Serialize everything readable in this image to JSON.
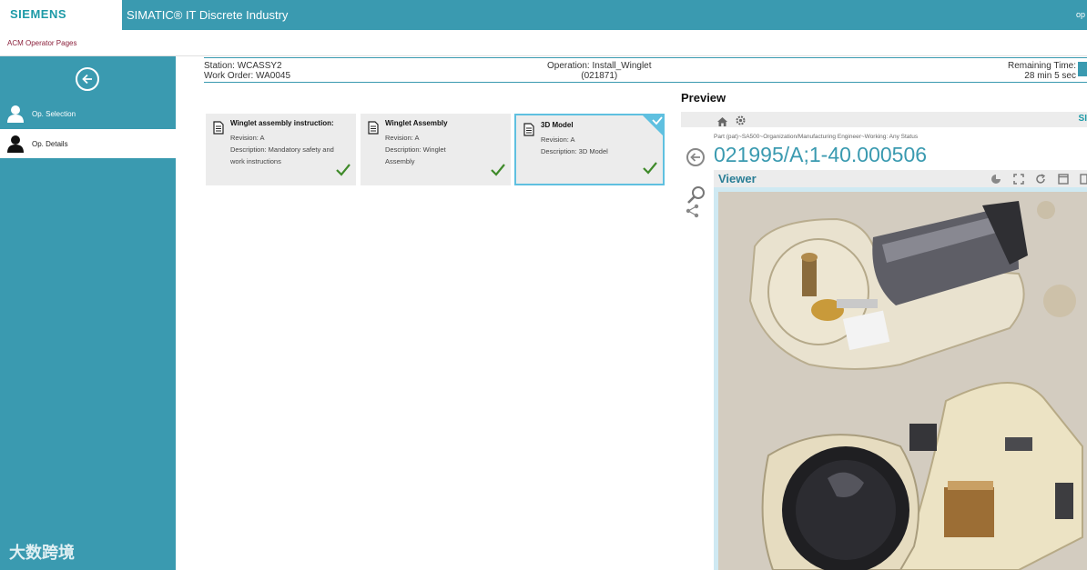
{
  "topbar": {
    "logo": "SIEMENS",
    "app_title": "SIMATIC® IT Discrete Industry",
    "right_text": "op"
  },
  "subbar": {
    "title": "ACM Operator Pages"
  },
  "sidebar": {
    "items": [
      {
        "label": "Op. Selection",
        "icon": "user-icon",
        "selected": false
      },
      {
        "label": "Op. Details",
        "icon": "user-icon",
        "selected": true
      }
    ],
    "watermark": "大数跨境"
  },
  "header": {
    "station": "Station: WCASSY2",
    "work_order": "Work Order: WA0045",
    "operation": "Operation: Install_Winglet",
    "operation_id": "(021871)",
    "remaining_label": "Remaining Time:",
    "remaining_value": "28 min 5 sec"
  },
  "cards": [
    {
      "title": "Winglet assembly instruction:",
      "revision": "Revision: A",
      "description": "Description: Mandatory safety and work instructions",
      "checked": true,
      "selected": false
    },
    {
      "title": "Winglet Assembly",
      "revision": "Revision: A",
      "description": "Description: Winglet Assembly",
      "checked": true,
      "selected": false
    },
    {
      "title": "3D Model",
      "revision": "Revision: A",
      "description": "Description: 3D Model",
      "checked": true,
      "selected": true
    }
  ],
  "preview": {
    "title": "Preview",
    "toolbar_brand": "SI",
    "breadcrumb": "Part (pat)~SA500~Organization/Manufacturing Engineer~Working: Any Status",
    "part_id": "021995/A;1-40.000506",
    "viewer_title": "Viewer",
    "viewer_image": "photo of disassembled motor and gear assembly"
  },
  "colors": {
    "accent": "#3a9ab0",
    "brand": "#1d9aa7",
    "check": "#3f8a2a",
    "selection_border": "#5fc0e0"
  }
}
